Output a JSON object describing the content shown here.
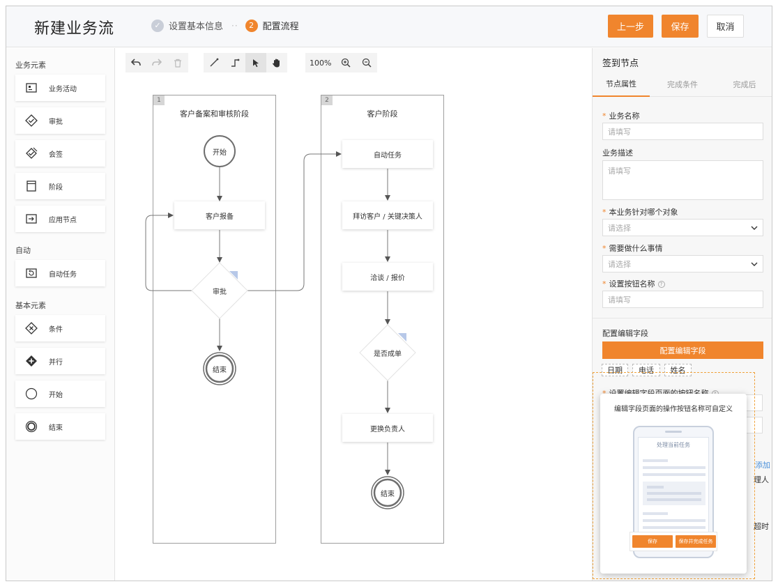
{
  "header": {
    "title": "新建业务流",
    "step1_label": "设置基本信息",
    "step_sep": "··",
    "step2_num": "2",
    "step2_label": "配置流程",
    "prev_label": "上一步",
    "save_label": "保存",
    "cancel_label": "取消",
    "accent": "#f0852d"
  },
  "palette": {
    "sections": [
      "业务元素",
      "自动",
      "基本元素"
    ],
    "items": [
      {
        "label": "业务活动",
        "icon": "id-card-icon"
      },
      {
        "label": "审批",
        "icon": "approval-diamond-icon"
      },
      {
        "label": "会签",
        "icon": "countersign-diamond-icon"
      },
      {
        "label": "阶段",
        "icon": "stage-icon"
      },
      {
        "label": "应用节点",
        "icon": "app-node-icon"
      },
      {
        "label": "自动任务",
        "icon": "auto-task-icon"
      },
      {
        "label": "条件",
        "icon": "condition-icon"
      },
      {
        "label": "并行",
        "icon": "parallel-icon"
      },
      {
        "label": "开始",
        "icon": "start-circle-icon"
      },
      {
        "label": "结束",
        "icon": "end-circle-icon"
      }
    ]
  },
  "toolbar": {
    "zoom": "100%"
  },
  "lanes": [
    {
      "num": "1",
      "title": "客户备案和审核阶段"
    },
    {
      "num": "2",
      "title": "客户阶段"
    }
  ],
  "nodes": {
    "start": "开始",
    "report": "客户报备",
    "approve": "审批",
    "end1": "结束",
    "auto_task": "自动任务",
    "visit": "拜访客户 / 关键决策人",
    "negotiate": "洽谈 / 报价",
    "deal": "是否成单",
    "change_owner": "更换负责人",
    "end2": "结束"
  },
  "panel": {
    "title": "签到节点",
    "tabs": [
      "节点属性",
      "完成条件",
      "完成后"
    ],
    "name_label": "业务名称",
    "name_placeholder": "请填写",
    "desc_label": "业务描述",
    "desc_placeholder": "请填写",
    "target_label": "本业务针对哪个对象",
    "target_placeholder": "请选择",
    "todo_label": "需要做什么事情",
    "todo_placeholder": "请选择",
    "btn_name_label": "设置按钮名称",
    "btn_name_placeholder": "请填写",
    "edit_fields_label": "配置编辑字段",
    "edit_fields_button": "配置编辑字段",
    "chips": [
      "日期",
      "电话",
      "姓名"
    ],
    "edit_btn_name_label": "设置编辑字段页面的按钮名称",
    "clip_add": "添加",
    "clip_person": "理人",
    "clip_timeout": "超时"
  },
  "popover": {
    "title": "编辑字段页面的操作按钮名称可自定义",
    "phone_title": "处理当前任务",
    "save": "保存",
    "save_complete": "保存并完成任务"
  }
}
